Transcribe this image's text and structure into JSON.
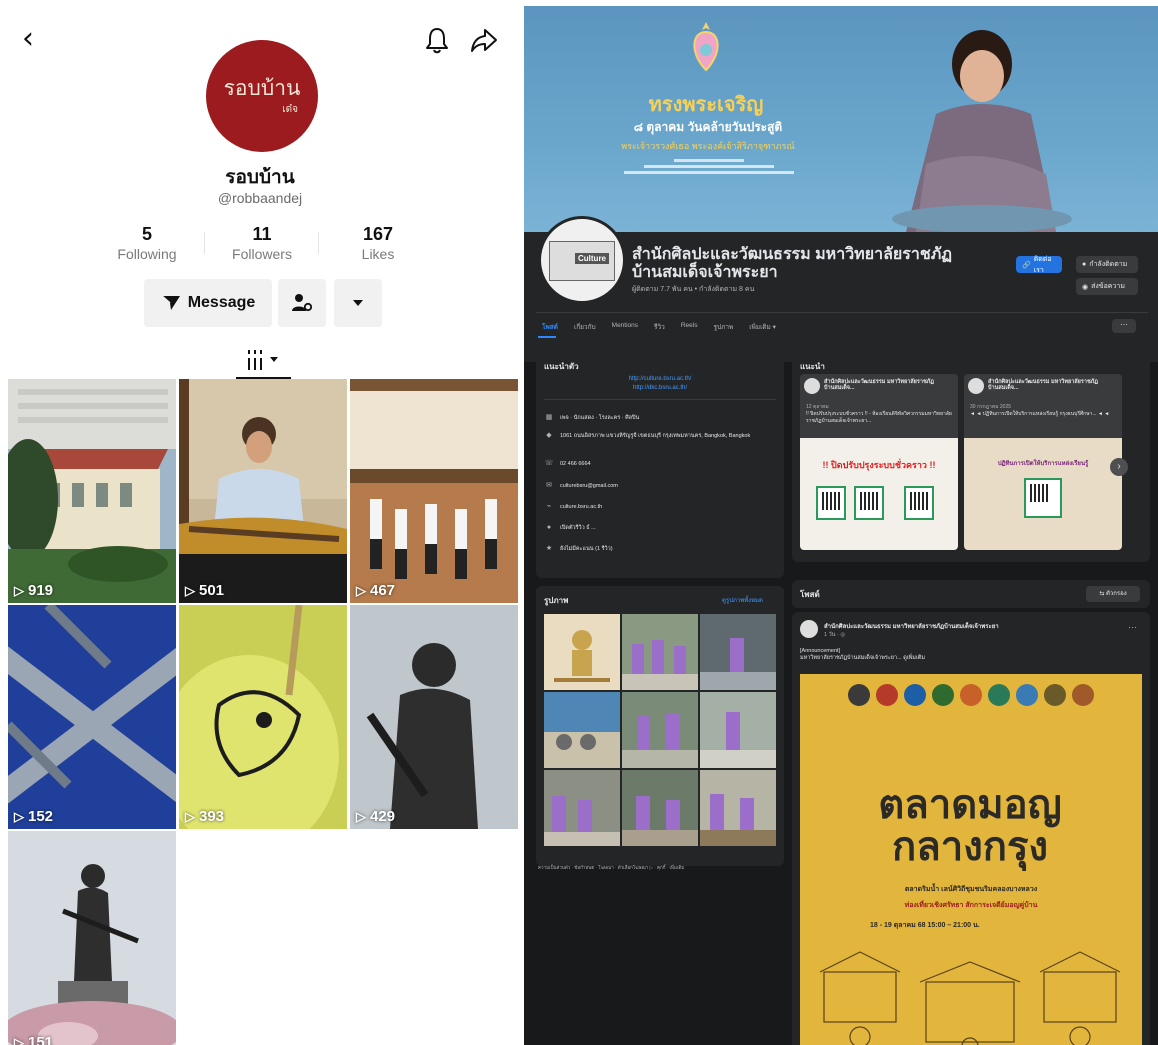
{
  "tiktok": {
    "profile_name": "รอบบ้าน",
    "handle": "@robbaandej",
    "avatar_logo_main": "รอบบ้าน",
    "avatar_logo_sub": "เด๋จ",
    "stats": [
      {
        "value": "5",
        "label": "Following"
      },
      {
        "value": "11",
        "label": "Followers"
      },
      {
        "value": "167",
        "label": "Likes"
      }
    ],
    "message_label": "Message",
    "videos": [
      {
        "views": "919",
        "scene": "white building with red roof"
      },
      {
        "views": "501",
        "scene": "student playing xylophone"
      },
      {
        "views": "467",
        "scene": "dancers performing on stage"
      },
      {
        "views": "152",
        "scene": "blue weaving pattern"
      },
      {
        "views": "393",
        "scene": "painting on yellow surface"
      },
      {
        "views": "429",
        "scene": "bronze statue"
      },
      {
        "views": "151",
        "scene": "statue on flower base"
      }
    ]
  },
  "facebook": {
    "cover": {
      "title": "ทรงพระเจริญ",
      "line1": "๘ ตุลาคม วันคล้ายวันประสูติ",
      "line2": "พระเจ้าวรวงศ์เธอ พระองค์เจ้าสิริภาจุฑาภรณ์"
    },
    "page_name": "สำนักศิลปะและวัฒนธรรม มหาวิทยาลัยราชภัฏบ้านสมเด็จเจ้าพระยา",
    "profile_tag": "Culture",
    "meta": "ผู้ติดตาม 7.7 พัน คน • กำลังติดตาม 8 คน",
    "actions": {
      "message": "ติดต่อเรา",
      "following": "กำลังติดตาม",
      "more": "ส่งข้อความ"
    },
    "tabs": [
      "โพสต์",
      "เกี่ยวกับ",
      "Mentions",
      "รีวิว",
      "Reels",
      "รูปภาพ",
      "เพิ่มเติม ▾"
    ],
    "intro": {
      "title": "แนะนำตัว",
      "links": [
        "http://culture.bsru.ac.th/",
        "http://dkc.bsru.ac.th/"
      ],
      "rows": [
        {
          "icon": "page-icon",
          "text": "เพจ · นักแสดง · โรงละคร · ศิลปิน"
        },
        {
          "icon": "location-icon",
          "text": "1061 ถนนอิสรภาพ แขวงหิรัญรูจี เขตธนบุรี กรุงเทพมหานคร, Bangkok, Bangkok"
        },
        {
          "icon": "phone-icon",
          "text": "02 466 6664"
        },
        {
          "icon": "mail-icon",
          "text": "culturebsru@gmail.com"
        },
        {
          "icon": "link-icon",
          "text": "culture.bsru.ac.th"
        },
        {
          "icon": "info-icon",
          "text": "เปิดตัวรีวิว ธ์ ..."
        },
        {
          "icon": "star-icon",
          "text": "ยังไม่มีคะแนน (1 รีวิว)"
        }
      ]
    },
    "recommended": {
      "title": "แนะนำ",
      "items": [
        {
          "author": "สำนักศิลปะและวัฒนธรรม มหาวิทยาลัยราชภัฏบ้านสมเด็จ...",
          "date": "12 ตุลาคม",
          "text": "!! ปิดปรับปรุงระบบชั่วคราว !! - ห้องเรียนดิจิทัลวิศวกรรมมหาวิทยาลัยราชภัฏบ้านสมเด็จเจ้าพระยา...",
          "banner": "!! ปิดปรับปรุงระบบชั่วคราว !!"
        },
        {
          "author": "สำนักศิลปะและวัฒนธรรม มหาวิทยาลัยราชภัฏบ้านสมเด็จ...",
          "date": "30 กรกฎาคม 2025",
          "text": "◄ ◄ ปฏิทินการเปิดให้บริการแหล่งเรียนรู้ กรุงธนบุรีศึกษา... ◄ ◄",
          "banner": "ปฏิทินการเปิดให้บริการแหล่งเรียนรู้"
        }
      ]
    },
    "photos": {
      "title": "รูปภาพ",
      "see_all": "ดูรูปภาพทั้งหมด"
    },
    "footer": "ความเป็นส่วนตัว · ข้อกำหนด · โฆษณา · ตัวเลือกโฆษณา ▷ · คุกกี้ · เพิ่มเติม",
    "posts": {
      "title": "โพสต์",
      "filter": "ตัวกรอง",
      "post": {
        "author": "สำนักศิลปะและวัฒนธรรม มหาวิทยาลัยราชภัฏบ้านสมเด็จเจ้าพระยา",
        "time": "1 วัน · ◎",
        "body_line1": "[Announcement]",
        "body_line2": "มหาวิทยาลัยราชภัฏบ้านสมเด็จเจ้าพระยา... ดูเพิ่มเติม",
        "poster_title_1": "ตลาดมอญ",
        "poster_title_2": "กลางกรุง",
        "poster_sub": "ตลาดริมน้ำ เลน์ศิวิถีชุมชนริมคลองบางหลวง",
        "poster_red": "ท่องเที่ยวเชิงศรัทธา สักการะเจดีย์มอญคู่บ้าน",
        "poster_date": "18 - 19 ตุลาคม 68  15:00 – 21:00 น."
      }
    }
  }
}
